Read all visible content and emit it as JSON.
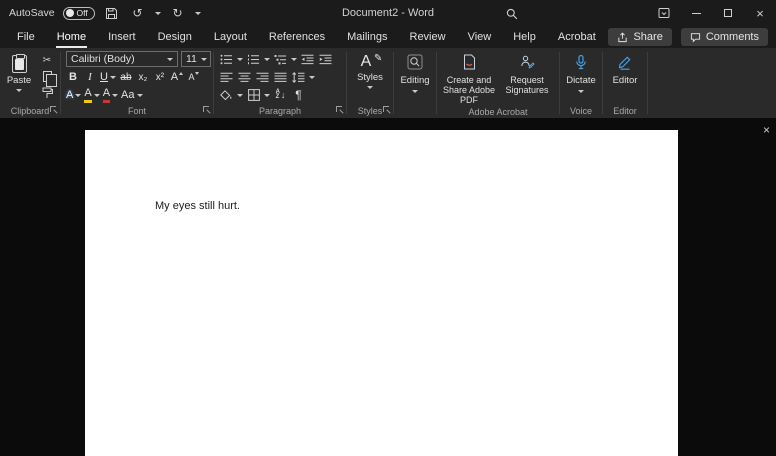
{
  "titlebar": {
    "autosave_label": "AutoSave",
    "autosave_state": "Off",
    "undo_glyph": "↺",
    "redo_glyph": "↻",
    "title": "Document2 - Word",
    "close_glyph": "×"
  },
  "menu": {
    "tabs": [
      "File",
      "Home",
      "Insert",
      "Design",
      "Layout",
      "References",
      "Mailings",
      "Review",
      "View",
      "Help",
      "Acrobat"
    ],
    "selected_tab": "Home",
    "share_label": "Share",
    "comments_label": "Comments"
  },
  "ribbon": {
    "clipboard": {
      "group_label": "Clipboard",
      "paste_label": "Paste",
      "cut_glyph": "✂"
    },
    "font": {
      "group_label": "Font",
      "font_name": "Calibri (Body)",
      "font_size": "11",
      "bold_glyph": "B",
      "italic_glyph": "I",
      "underline_glyph": "U",
      "strikethrough_glyph": "ab",
      "subscript_glyph": "x₂",
      "superscript_glyph": "x²",
      "grow_font_glyph": "A",
      "shrink_font_glyph": "A",
      "text_effects_glyph": "A",
      "highlight_glyph": "A",
      "font_color_glyph": "A",
      "change_case_glyph": "Aa"
    },
    "paragraph": {
      "group_label": "Paragraph",
      "sort_a": "A",
      "sort_z": "Z",
      "sort_arrow": "↓",
      "pilcrow_glyph": "¶"
    },
    "styles": {
      "group_label": "Styles",
      "button_label": "Styles",
      "icon_letter": "A",
      "icon_pen": "✎"
    },
    "editing": {
      "button_label": "Editing"
    },
    "acrobat": {
      "group_label": "Adobe Acrobat",
      "create_pdf_label": "Create and Share Adobe PDF",
      "request_signatures_label": "Request Signatures"
    },
    "voice": {
      "group_label": "Voice",
      "dictate_label": "Dictate"
    },
    "editor": {
      "group_label": "Editor",
      "button_label": "Editor"
    }
  },
  "document": {
    "body_text": "My eyes still hurt.",
    "close_glyph": "×"
  },
  "colors": {
    "accent_blue": "#42a0e8",
    "highlight_yellow": "#f2c811",
    "font_color_red": "#d13438",
    "page_white": "#ffffff",
    "titlebar_bg": "#1b1b1b",
    "ribbon_bg": "#2a2a2a"
  }
}
